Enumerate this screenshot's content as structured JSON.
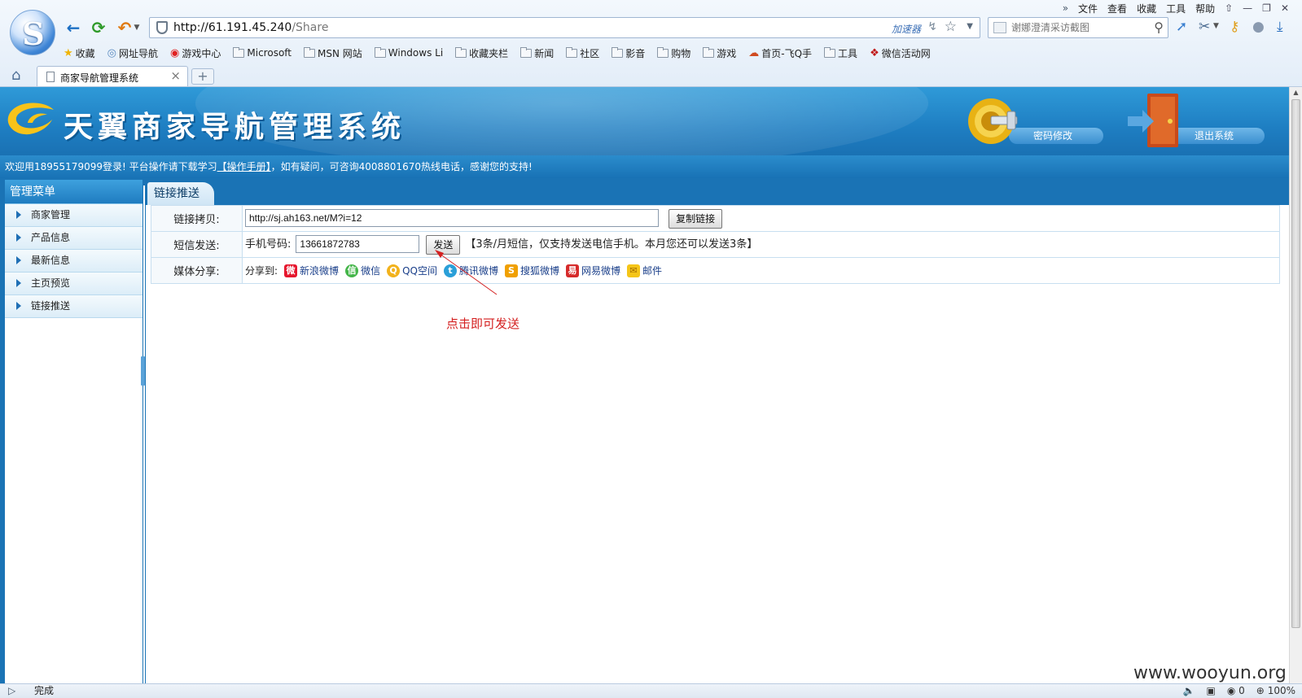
{
  "browser": {
    "url_host": "http://61.191.45.240",
    "url_path": "/Share",
    "accelerator_label": "加速器",
    "search_placeholder": "谢娜澄清采访截图",
    "menu": [
      "文件",
      "查看",
      "收藏",
      "工具",
      "帮助"
    ],
    "bookmarks": [
      {
        "label": "收藏",
        "icon": "star-icon"
      },
      {
        "label": "网址导航",
        "icon": "globe-icon"
      },
      {
        "label": "游戏中心",
        "icon": "game-icon"
      },
      {
        "label": "Microsoft",
        "icon": "folder-icon"
      },
      {
        "label": "MSN 网站",
        "icon": "folder-icon"
      },
      {
        "label": "Windows Li",
        "icon": "folder-icon"
      },
      {
        "label": "收藏夹栏",
        "icon": "folder-icon"
      },
      {
        "label": "新闻",
        "icon": "folder-icon"
      },
      {
        "label": "社区",
        "icon": "folder-icon"
      },
      {
        "label": "影音",
        "icon": "folder-icon"
      },
      {
        "label": "购物",
        "icon": "folder-icon"
      },
      {
        "label": "游戏",
        "icon": "folder-icon"
      },
      {
        "label": "首页-飞Q手",
        "icon": "cloud-icon"
      },
      {
        "label": "工具",
        "icon": "folder-icon"
      },
      {
        "label": "微信活动网",
        "icon": "gift-icon"
      }
    ],
    "tab_title": "商家导航管理系统",
    "status_text": "完成",
    "status_count": "0",
    "zoom": "100%"
  },
  "site": {
    "title": "天翼商家导航管理系统",
    "pwd_btn": "密码修改",
    "logout_btn": "退出系统",
    "welcome": {
      "prefix": "欢迎用18955179099登录!   平台操作请下载学习",
      "manual": "【操作手册】",
      "suffix": "，如有疑问，可咨询4008801670热线电话，感谢您的支持!"
    }
  },
  "sidebar": {
    "title": "管理菜单",
    "items": [
      "商家管理",
      "产品信息",
      "最新信息",
      "主页预览",
      "链接推送"
    ]
  },
  "main": {
    "tab": "链接推送",
    "copy_label": "链接拷贝:",
    "copy_value": "http://sj.ah163.net/M?i=12",
    "copy_btn": "复制链接",
    "sms_label": "短信发送:",
    "phone_label": "手机号码:",
    "phone_value": "13661872783",
    "send_btn": "发送",
    "sms_note": "【3条/月短信，仅支持发送电信手机。本月您还可以发送3条】",
    "media_label": "媒体分享:",
    "share_prefix": "分享到:",
    "share": [
      {
        "label": "新浪微博",
        "icon": "sina-weibo-icon",
        "color": "#e6162d",
        "glyph": "微"
      },
      {
        "label": "微信",
        "icon": "wechat-icon",
        "color": "#44b549",
        "glyph": "信"
      },
      {
        "label": "QQ空间",
        "icon": "qzone-icon",
        "color": "#f2b21c",
        "glyph": "Q"
      },
      {
        "label": "腾讯微博",
        "icon": "tencent-weibo-icon",
        "color": "#2a9fd8",
        "glyph": "t"
      },
      {
        "label": "搜狐微博",
        "icon": "sohu-weibo-icon",
        "color": "#f0a000",
        "glyph": "S"
      },
      {
        "label": "网易微博",
        "icon": "netease-weibo-icon",
        "color": "#d62a2a",
        "glyph": "易"
      },
      {
        "label": "邮件",
        "icon": "mail-icon",
        "color": "#f5c518",
        "glyph": "✉"
      }
    ]
  },
  "annotation": "点击即可发送",
  "watermark": "www.wooyun.org"
}
